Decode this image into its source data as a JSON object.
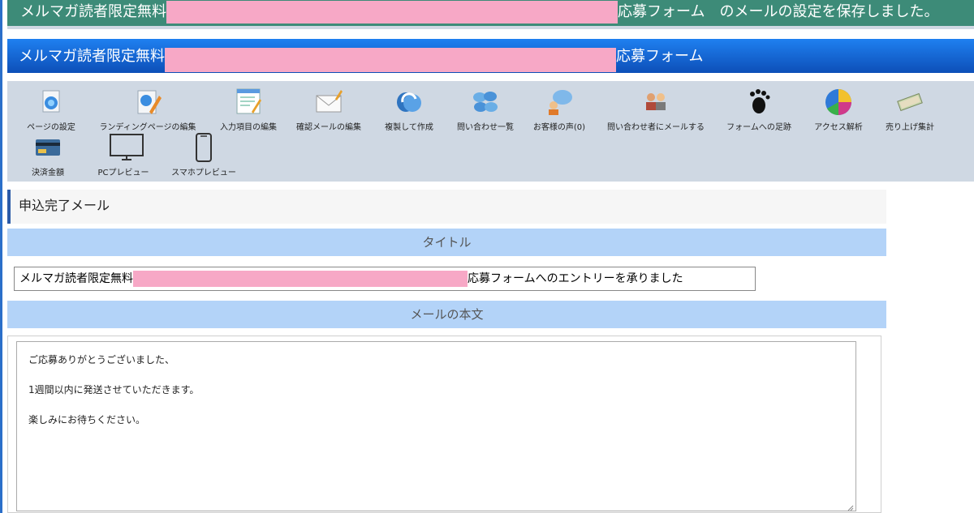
{
  "notice": {
    "prefix": "メルマガ読者限定無料",
    "suffix": "応募フォーム　のメールの設定を保存しました。"
  },
  "form_bar": {
    "prefix": "メルマガ読者限定無料",
    "suffix": "応募フォーム"
  },
  "toolbar": {
    "items": [
      {
        "label": "ページの設定",
        "icon": "page-settings-icon"
      },
      {
        "label": "ランディングページの編集",
        "icon": "landing-page-edit-icon"
      },
      {
        "label": "入力項目の編集",
        "icon": "input-fields-edit-icon"
      },
      {
        "label": "確認メールの編集",
        "icon": "mail-edit-icon"
      },
      {
        "label": "複製して作成",
        "icon": "duplicate-icon"
      },
      {
        "label": "問い合わせ一覧",
        "icon": "inquiry-list-icon"
      },
      {
        "label": "お客様の声(0)",
        "icon": "customer-voice-icon"
      },
      {
        "label": "問い合わせ者にメールする",
        "icon": "mail-inquirers-icon"
      },
      {
        "label": "フォームへの足跡",
        "icon": "footprint-icon"
      },
      {
        "label": "アクセス解析",
        "icon": "pie-chart-icon"
      },
      {
        "label": "売り上げ集計",
        "icon": "money-icon"
      },
      {
        "label": "決済金額",
        "icon": "credit-card-icon"
      },
      {
        "label": "PCプレビュー",
        "icon": "monitor-icon"
      },
      {
        "label": "スマホプレビュー",
        "icon": "smartphone-icon"
      }
    ]
  },
  "section": {
    "title": "申込完了メール"
  },
  "fields": {
    "title_label": "タイトル",
    "title_value_prefix": "メルマガ読者限定無料",
    "title_value_suffix": "応募フォームへのエントリーを承りました",
    "body_label": "メールの本文",
    "body_lines": [
      "ご応募ありがとうございました、",
      "1週間以内に発送させていただきます。",
      "楽しみにお待ちください。"
    ]
  },
  "colors": {
    "notice_bg": "#3d8b78",
    "form_bar_bg": "#0d5fd0",
    "toolbar_bg": "#cfd8e3",
    "label_bar_bg": "#b3d3f8",
    "redaction": "#f7a8c6"
  }
}
